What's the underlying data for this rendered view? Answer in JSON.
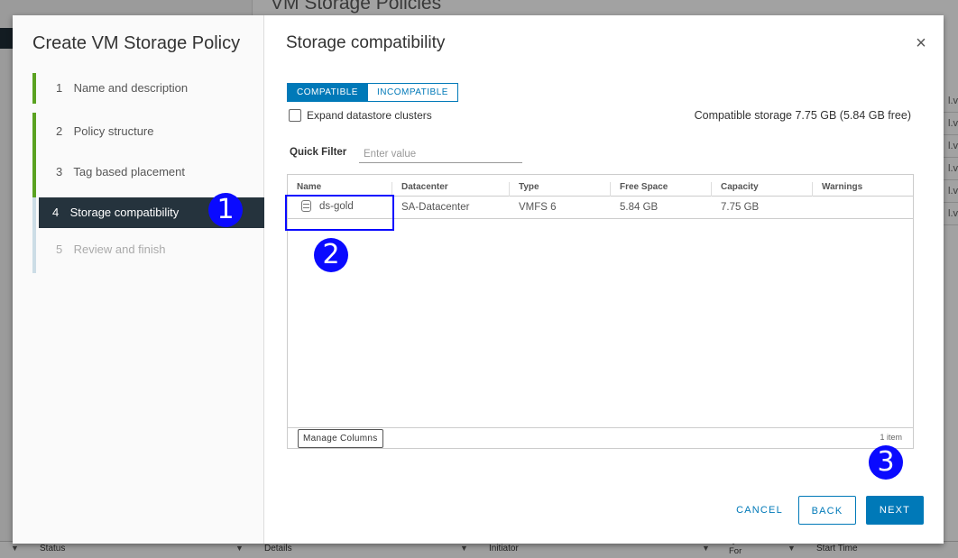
{
  "background": {
    "page_title": "VM Storage Policies",
    "right_col_rows": [
      "l.vc",
      "l.vc",
      "l.vc",
      "l.vc",
      "l.vc",
      "l.vc"
    ],
    "bottom_columns": [
      "Status",
      "Details",
      "Initiator",
      "Queued For",
      "Start Time"
    ]
  },
  "wizard": {
    "title": "Create VM Storage Policy",
    "steps": [
      {
        "num": "1",
        "label": "Name and description",
        "state": "done"
      },
      {
        "num": "2",
        "label": "Policy structure",
        "state": "done"
      },
      {
        "num": "3",
        "label": "Tag based placement",
        "state": "done"
      },
      {
        "num": "4",
        "label": "Storage compatibility",
        "state": "active"
      },
      {
        "num": "5",
        "label": "Review and finish",
        "state": "pending"
      }
    ]
  },
  "content": {
    "title": "Storage compatibility",
    "close_icon": "close-icon",
    "toggle": {
      "compatible": "COMPATIBLE",
      "incompatible": "INCOMPATIBLE",
      "selected": "COMPATIBLE"
    },
    "expand_clusters_label": "Expand datastore clusters",
    "expand_clusters_checked": false,
    "compatible_storage": "Compatible storage 7.75 GB (5.84 GB free)",
    "quick_filter": {
      "label": "Quick Filter",
      "placeholder": "Enter value",
      "value": ""
    },
    "grid": {
      "columns": [
        "Name",
        "Datacenter",
        "Type",
        "Free Space",
        "Capacity",
        "Warnings"
      ],
      "rows": [
        {
          "name": "ds-gold",
          "datacenter": "SA-Datacenter",
          "type": "VMFS 6",
          "free_space": "5.84 GB",
          "capacity": "7.75 GB",
          "warnings": ""
        }
      ],
      "manage_columns": "Manage Columns",
      "item_count": "1 item"
    },
    "buttons": {
      "cancel": "CANCEL",
      "back": "BACK",
      "next": "NEXT"
    }
  },
  "annotations": {
    "m1": "1",
    "m2": "2",
    "m3": "3"
  },
  "colors": {
    "accent": "#0079b8",
    "done_step": "#5aa220",
    "active_step_bg": "#25333d",
    "annotation": "#0a0aff"
  }
}
